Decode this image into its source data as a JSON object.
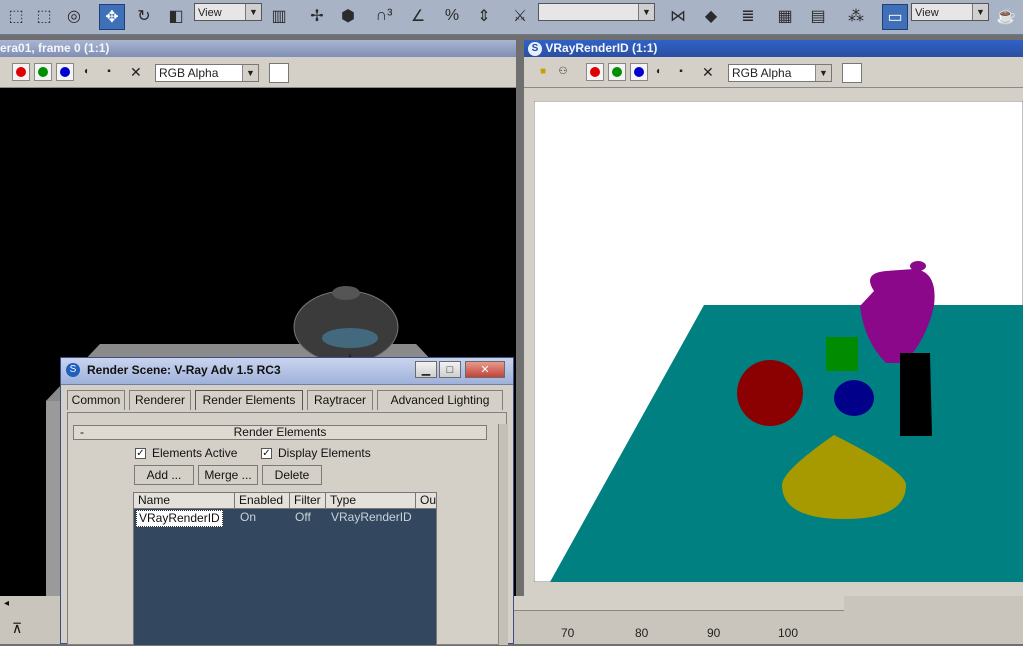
{
  "toolbar": {
    "view_dropdown_1": "View",
    "view_dropdown_2": "View",
    "icons": [
      "select-rect-icon",
      "select-region-icon",
      "select-circle-icon",
      "move-icon",
      "rotate-icon",
      "scale-icon",
      "view-dropdown",
      "use-pivot-icon",
      "snap-toggle-icon",
      "manipulate-icon",
      "angle-snap-icon",
      "percent-snap-icon",
      "spinner-snap-icon",
      "named-selection-icon",
      "mirror-icon",
      "align-icon",
      "layer-manager-icon",
      "curve-editor-icon",
      "schematic-view-icon",
      "material-editor-icon",
      "render-setup-icon",
      "render-teapot-icon"
    ]
  },
  "left_frame": {
    "title": "era01, frame 0 (1:1)",
    "channel_dropdown": "RGB Alpha"
  },
  "right_frame": {
    "title": "VRayRenderID (1:1)",
    "channel_dropdown": "RGB Alpha"
  },
  "dialog": {
    "title": "Render Scene: V-Ray Adv 1.5 RC3",
    "tabs": [
      "Common",
      "Renderer",
      "Render Elements",
      "Raytracer",
      "Advanced Lighting"
    ],
    "active_tab": "Render Elements",
    "rollout_title": "Render Elements",
    "rollout_toggle": "-",
    "elements_active_label": "Elements Active",
    "display_elements_label": "Display Elements",
    "add_label": "Add ...",
    "merge_label": "Merge ...",
    "delete_label": "Delete",
    "columns": [
      "Name",
      "Enabled",
      "Filter",
      "Type",
      "Ou"
    ],
    "rows": [
      {
        "name": "VRayRenderID",
        "enabled": "On",
        "filter": "Off",
        "type": "VRayRenderID"
      }
    ]
  },
  "timeline": {
    "ticks": [
      "70",
      "80",
      "90",
      "100"
    ]
  },
  "colors": {
    "accent": "#3f6fb6",
    "render_bg": "#ffffff",
    "table_teal": "#008080",
    "teapot_purple": "#8b088b",
    "sphere_red": "#8b0000",
    "cylinder_green": "#008b00",
    "blue_obj": "#00008b",
    "cone_olive": "#a69a00"
  }
}
